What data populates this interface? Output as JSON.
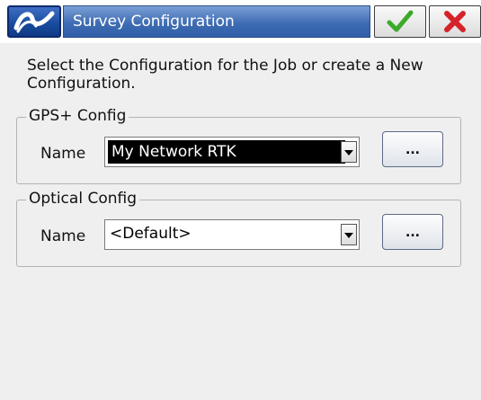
{
  "window": {
    "title": "Survey Configuration",
    "ok_icon": "checkmark-icon",
    "close_icon": "close-x-icon",
    "logo_icon": "app-logo-icon"
  },
  "intro_text": "Select the Configuration for the Job or create a New Configuration.",
  "gps_config": {
    "legend": "GPS+ Config",
    "name_label": "Name",
    "selected_value": "My Network RTK",
    "browse_label": "..."
  },
  "optical_config": {
    "legend": "Optical Config",
    "name_label": "Name",
    "selected_value": "<Default>",
    "browse_label": "..."
  },
  "colors": {
    "title_bar": "#3f6cb3",
    "ok_check": "#3caa2a",
    "close_x": "#d6232a"
  }
}
